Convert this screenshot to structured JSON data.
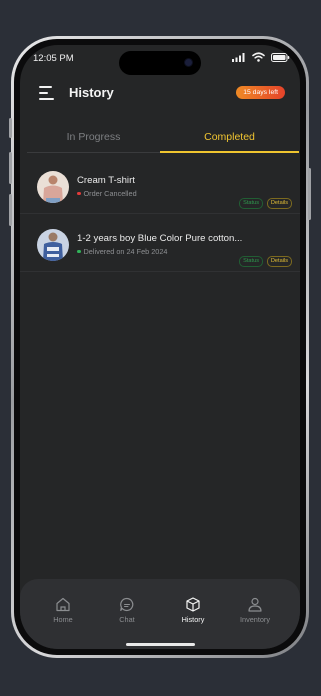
{
  "status_bar": {
    "time": "12:05 PM"
  },
  "header": {
    "title": "History",
    "badge": "15 days left"
  },
  "tabs": [
    {
      "label": "In Progress",
      "active": false
    },
    {
      "label": "Completed",
      "active": true
    }
  ],
  "orders": [
    {
      "name": "Cream T-shirt",
      "status": "Order Cancelled",
      "status_color": "#e23b3b",
      "status_chip": "Status",
      "details_chip": "Details"
    },
    {
      "name": "1-2 years boy Blue Color Pure cotton...",
      "status": "Delivered on 24 Feb 2024",
      "status_color": "#31b35a",
      "status_chip": "Status",
      "details_chip": "Details"
    }
  ],
  "bottom_nav": [
    {
      "label": "Home",
      "icon": "home-icon",
      "active": false
    },
    {
      "label": "Chat",
      "icon": "chat-icon",
      "active": false
    },
    {
      "label": "History",
      "icon": "box-icon",
      "active": true
    },
    {
      "label": "Inventory",
      "icon": "person-icon",
      "active": false
    }
  ],
  "colors": {
    "accent": "#efc52f",
    "background": "#252627",
    "badge_start": "#ef8a25",
    "badge_end": "#e5432a"
  }
}
